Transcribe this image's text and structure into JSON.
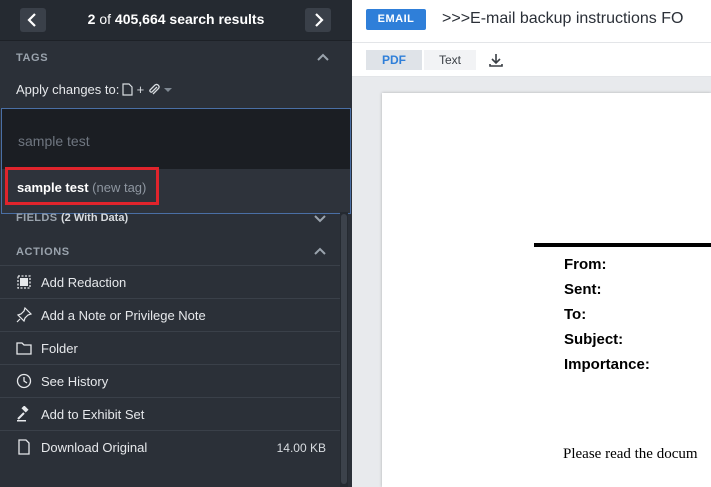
{
  "pager": {
    "prev_icon": "chevron-left-icon",
    "next_icon": "chevron-right-icon",
    "current": "2",
    "of_label": "of",
    "total": "405,664",
    "suffix": "search results"
  },
  "tags": {
    "header": "TAGS",
    "apply_label": "Apply changes to:",
    "apply_icons": "document-icon + paperclip-icon",
    "apply_plus": "+",
    "input_placeholder": "sample test",
    "option_name": "sample test",
    "option_hint": "(new tag)"
  },
  "fields": {
    "header": "FIELDS",
    "sub": "(2 With Data)"
  },
  "actions": {
    "header": "ACTIONS",
    "items": [
      {
        "label": "Add Redaction",
        "icon": "redaction-icon"
      },
      {
        "label": "Add a Note or Privilege Note",
        "icon": "pin-icon"
      },
      {
        "label": "Folder",
        "icon": "folder-icon"
      },
      {
        "label": "See History",
        "icon": "clock-icon"
      },
      {
        "label": "Add to Exhibit Set",
        "icon": "gavel-icon"
      },
      {
        "label": "Download Original",
        "icon": "file-icon",
        "size": "14.00 KB"
      }
    ]
  },
  "document": {
    "type_badge": "EMAIL",
    "title": ">>>E-mail backup instructions FO",
    "view_tabs": {
      "pdf": "PDF",
      "text": "Text"
    },
    "download_icon": "download-icon",
    "headers": [
      "From:",
      "Sent:",
      "To:",
      "Subject:",
      "Importance:"
    ],
    "body_start": "Please read the docum"
  },
  "colors": {
    "sidebar_bg": "#2b3038",
    "accent_blue": "#2f7fd9",
    "highlight_red": "#e0242c"
  }
}
